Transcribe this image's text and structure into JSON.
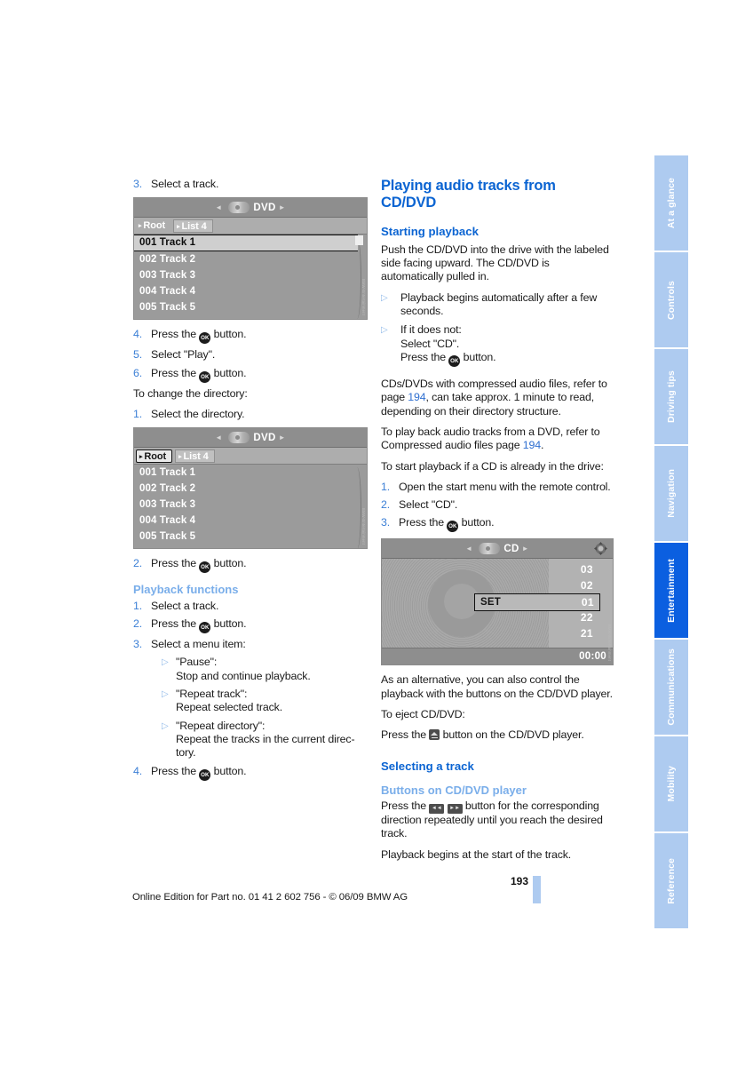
{
  "page_number": "193",
  "footer_line": "Online Edition for Part no. 01 41 2 602 756 - © 06/09 BMW AG",
  "index_tabs": [
    {
      "label": "At a glance",
      "active": false
    },
    {
      "label": "Controls",
      "active": false
    },
    {
      "label": "Driving tips",
      "active": false
    },
    {
      "label": "Navigation",
      "active": false
    },
    {
      "label": "Entertainment",
      "active": true
    },
    {
      "label": "Communications",
      "active": false
    },
    {
      "label": "Mobility",
      "active": false
    },
    {
      "label": "Reference",
      "active": false
    }
  ],
  "left_column": {
    "step3_num": "3.",
    "step3_text": "Select a track.",
    "shot1": {
      "title": "DVD",
      "nav_left": "◄",
      "nav_right": "►",
      "tabs": [
        {
          "label": "Root",
          "selected": false
        },
        {
          "label": "List 4",
          "selected": true
        }
      ],
      "tracks": [
        {
          "label": "001 Track 1",
          "selected": true
        },
        {
          "label": "002 Track 2",
          "selected": false
        },
        {
          "label": "003 Track 3",
          "selected": false
        },
        {
          "label": "004 Track 4",
          "selected": false
        },
        {
          "label": "005 Track 5",
          "selected": false
        }
      ],
      "caption": "BMW-Entertainment"
    },
    "step4_num": "4.",
    "step4_pre": "Press the",
    "step4_post": "button.",
    "step5_num": "5.",
    "step5_text": "Select \"Play\".",
    "step6_num": "6.",
    "step6_pre": "Press the",
    "step6_post": "button.",
    "change_dir_intro": "To change the directory:",
    "dir_step1_num": "1.",
    "dir_step1_text": "Select the directory.",
    "shot2": {
      "title": "DVD",
      "nav_left": "◄",
      "nav_right": "►",
      "tabs": [
        {
          "label": "Root",
          "selected": true
        },
        {
          "label": "List 4",
          "selected": false
        }
      ],
      "tracks": [
        {
          "label": "001 Track 1",
          "selected": false
        },
        {
          "label": "002 Track 2",
          "selected": false
        },
        {
          "label": "003 Track 3",
          "selected": false
        },
        {
          "label": "004 Track 4",
          "selected": false
        },
        {
          "label": "005 Track 5",
          "selected": false
        }
      ],
      "caption": "BMW-Entertainment"
    },
    "dir_step2_num": "2.",
    "dir_step2_pre": "Press the",
    "dir_step2_post": "button.",
    "playback_heading": "Playback functions",
    "pb_step1_num": "1.",
    "pb_step1_text": "Select a track.",
    "pb_step2_num": "2.",
    "pb_step2_pre": "Press the",
    "pb_step2_post": "button.",
    "pb_step3_num": "3.",
    "pb_step3_text": "Select a menu item:",
    "pb_bullets": [
      {
        "title": "\"Pause\":",
        "body": "Stop and continue playback."
      },
      {
        "title": "\"Repeat track\":",
        "body": "Repeat selected track."
      },
      {
        "title": "\"Repeat directory\":",
        "body": "Repeat the tracks in the current direc-\ntory."
      }
    ],
    "pb_step4_num": "4.",
    "pb_step4_pre": "Press the",
    "pb_step4_post": "button."
  },
  "right_column": {
    "title": "Playing audio tracks from CD/DVD",
    "starting_heading": "Starting playback",
    "starting_para": "Push the CD/DVD into the drive with the labeled side facing upward. The CD/DVD is automatically pulled in.",
    "bullet1": "Playback begins automatically after a few seconds.",
    "bullet2_l1": "If it does not:",
    "bullet2_l2": "Select \"CD\".",
    "bullet2_pre": "Press the",
    "bullet2_post": "button.",
    "compressed_p1_a": "CDs/DVDs with compressed audio files, refer to page",
    "compressed_p1_page": "194",
    "compressed_p1_b": ", can take approx. 1 minute to read, depending on their directory structure.",
    "dvd_p_a": "To play back audio tracks from a DVD, refer to Compressed audio files page",
    "dvd_p_page": "194",
    "dvd_p_b": ".",
    "start_if_intro": "To start playback if a CD is already in the drive:",
    "s1_num": "1.",
    "s1_text": "Open the start menu with the remote control.",
    "s2_num": "2.",
    "s2_text": "Select \"CD\".",
    "s3_num": "3.",
    "s3_pre": "Press the",
    "s3_post": "button.",
    "cd_shot": {
      "title": "CD",
      "nav_left": "◄",
      "nav_right": "►",
      "numbers_above": [
        "03",
        "02"
      ],
      "selected_label": "SET",
      "selected_track": "01",
      "numbers_below": [
        "22",
        "21"
      ],
      "time": "00:00",
      "caption": "BMW-Entertainment"
    },
    "alt_para": "As an alternative, you can also control the playback with the buttons on the CD/DVD player.",
    "eject_intro": "To eject CD/DVD:",
    "eject_pre": "Press the",
    "eject_post": "button on the CD/DVD player.",
    "selecting_heading": "Selecting a track",
    "buttons_heading": "Buttons on CD/DVD player",
    "buttons_pre": "Press the",
    "buttons_mid": "button for the corresponding direction repeatedly until you reach the desired track.",
    "buttons_after": "Playback begins at the start of the track.",
    "icon_prev": "◄◄",
    "icon_next": "►►",
    "ok_icon_label": "OK"
  },
  "colors": {
    "heading_blue": "#0b64d2",
    "sub_blue": "#7aaeea",
    "tab_blue": "#aecbf0",
    "tab_active": "#0b5fe0",
    "link_blue": "#2f6fd0"
  }
}
